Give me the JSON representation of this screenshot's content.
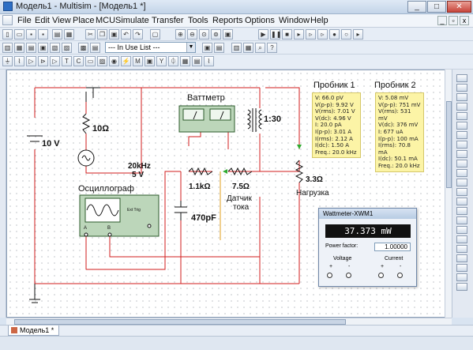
{
  "window": {
    "title": "Модель1 - Multisim - [Модель1 *]"
  },
  "menu": [
    "File",
    "Edit",
    "View",
    "Place",
    "MCU",
    "Simulate",
    "Transfer",
    "Tools",
    "Reports",
    "Options",
    "Window",
    "Help"
  ],
  "toolbar": {
    "in_use_list": "--- In Use List ---"
  },
  "circuit": {
    "source_dc": "10 V",
    "r1": "10Ω",
    "ac_source_freq": "20kHz",
    "ac_source_volt": "5 V",
    "wattmeter_label": "Ваттметр",
    "transformer_ratio": "1:30",
    "oscilloscope_label": "Осциллограф",
    "ext_trig": "Ext Trig",
    "osc_a": "A",
    "osc_b": "B",
    "r2": "1.1kΩ",
    "r3": "7.5Ω",
    "current_sensor": "Датчик",
    "current_sensor2": "тока",
    "capacitor": "470pF",
    "load_value": "3.3Ω",
    "load_label": "Нагрузка"
  },
  "probe1": {
    "title": "Пробник 1",
    "lines": [
      "V: 66.0 pV",
      "V(p-p): 9.92 V",
      "V(rms): 7.01 V",
      "V(dc): 4.96 V",
      "I: 20.0 pA",
      "I(p-p): 3.01 A",
      "I(rms): 2.12 A",
      "I(dc): 1.50 A",
      "Freq.: 20.0 kHz"
    ]
  },
  "probe2": {
    "title": "Пробник 2",
    "lines": [
      "V: 5.08 mV",
      "V(p-p): 751 mV",
      "V(rms): 531 mV",
      "V(dc): 376 mV",
      "I: 677 uA",
      "I(p-p): 100 mA",
      "I(rms): 70.8 mA",
      "I(dc): 50.1 mA",
      "Freq.: 20.0 kHz"
    ]
  },
  "wattmeter_window": {
    "title": "Wattmeter-XWM1",
    "reading": "37.373 mW",
    "pf_label": "Power factor:",
    "pf_value": "1.00000",
    "voltage": "Voltage",
    "current": "Current",
    "plus": "+",
    "minus": "-"
  },
  "tabs": {
    "model": "Модель1 *"
  }
}
